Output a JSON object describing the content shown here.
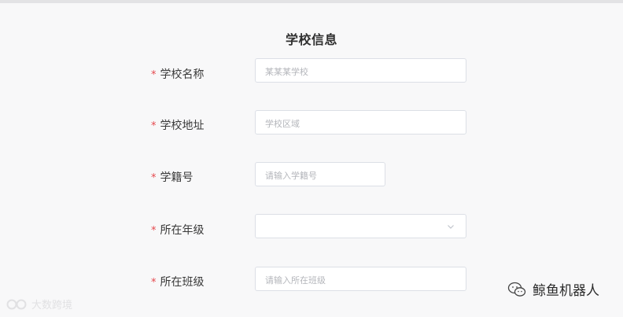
{
  "form": {
    "title": "学校信息",
    "required_mark": "*",
    "fields": [
      {
        "label": "学校名称",
        "placeholder": "某某某学校",
        "type": "text"
      },
      {
        "label": "学校地址",
        "placeholder": "学校区域",
        "type": "text"
      },
      {
        "label": "学籍号",
        "placeholder": "请输入学籍号",
        "type": "text"
      },
      {
        "label": "所在年级",
        "placeholder": "",
        "type": "select"
      },
      {
        "label": "所在班级",
        "placeholder": "请输入所在班级",
        "type": "text"
      }
    ]
  },
  "watermarks": {
    "left_text": "大数跨境",
    "right_text": "鲸鱼机器人"
  },
  "icons": {
    "select_chevron": "chevron-down-icon",
    "left_logo": "brand-logo-icon",
    "right_logo": "wechat-icon"
  }
}
